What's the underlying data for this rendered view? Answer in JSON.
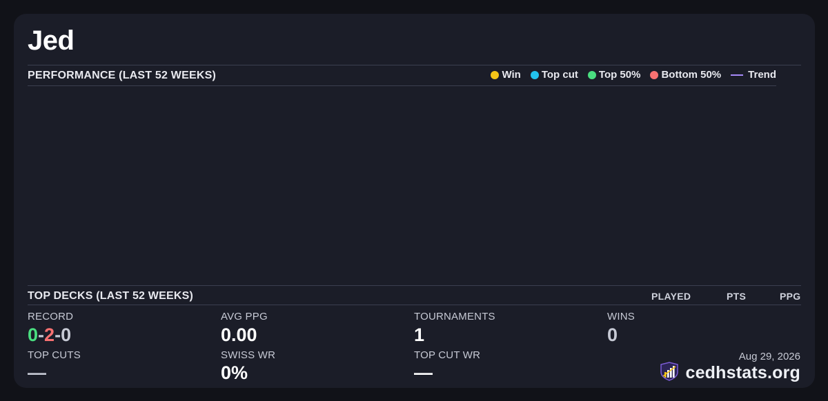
{
  "player": {
    "name": "Jed"
  },
  "performance": {
    "title": "PERFORMANCE (LAST 52 WEEKS)",
    "legend": [
      {
        "label": "Win",
        "color": "#f5c518",
        "shape": "dot"
      },
      {
        "label": "Top cut",
        "color": "#22c3ee",
        "shape": "dot"
      },
      {
        "label": "Top 50%",
        "color": "#4ade80",
        "shape": "dot"
      },
      {
        "label": "Bottom 50%",
        "color": "#f87171",
        "shape": "dot"
      },
      {
        "label": "Trend",
        "color": "#a78bfa",
        "shape": "line"
      }
    ]
  },
  "top_decks": {
    "title": "TOP DECKS (LAST 52 WEEKS)",
    "columns": [
      "PLAYED",
      "PTS",
      "PPG"
    ]
  },
  "stats": {
    "record": {
      "label": "RECORD",
      "wins": "0",
      "losses": "2",
      "draws": "0",
      "sep": "-"
    },
    "avg_ppg": {
      "label": "AVG PPG",
      "value": "0.00"
    },
    "tournaments": {
      "label": "TOURNAMENTS",
      "value": "1"
    },
    "wins": {
      "label": "WINS",
      "value": "0"
    },
    "top_cuts": {
      "label": "TOP CUTS",
      "value": "—"
    },
    "swiss_wr": {
      "label": "SWISS WR",
      "value": "0%"
    },
    "top_cut_wr": {
      "label": "TOP CUT WR",
      "value": "—"
    }
  },
  "colors": {
    "record_win": "#4ade80",
    "record_loss": "#f87171",
    "record_draw": "#c7cad5",
    "muted_value": "#c7cad5"
  },
  "footer": {
    "date": "Aug 29, 2026",
    "brand": "cedhstats.org",
    "logo_icon": "bar-chart-shield-icon"
  }
}
